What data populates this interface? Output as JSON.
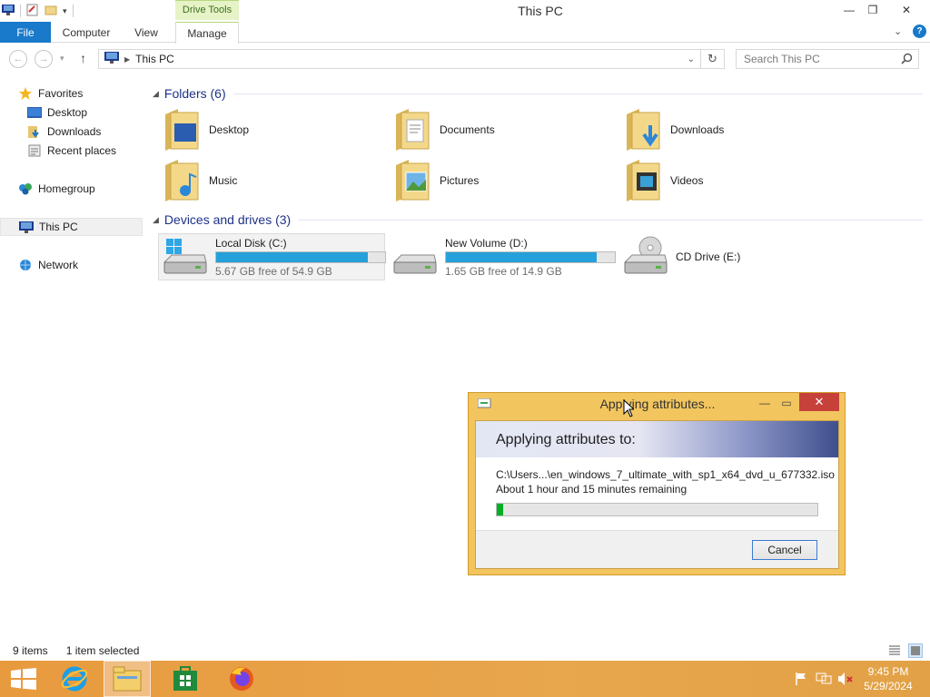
{
  "window": {
    "title": "This PC",
    "context_tab": "Drive Tools",
    "tabs": [
      "File",
      "Computer",
      "View",
      "Manage"
    ]
  },
  "address": {
    "path": "This PC",
    "search_placeholder": "Search This PC"
  },
  "nav": {
    "favorites": "Favorites",
    "desktop": "Desktop",
    "downloads": "Downloads",
    "recent": "Recent places",
    "homegroup": "Homegroup",
    "thispc": "This PC",
    "network": "Network"
  },
  "folders": {
    "header": "Folders (6)",
    "items": [
      "Desktop",
      "Documents",
      "Downloads",
      "Music",
      "Pictures",
      "Videos"
    ]
  },
  "drives": {
    "header": "Devices and drives (3)",
    "c": {
      "name": "Local Disk (C:)",
      "free": "5.67 GB free of 54.9 GB",
      "used_fraction": 0.9
    },
    "d": {
      "name": "New Volume (D:)",
      "free": "1.65 GB free of 14.9 GB",
      "used_fraction": 0.89
    },
    "e": {
      "name": "CD Drive (E:)"
    }
  },
  "status": {
    "items": "9 items",
    "selected": "1 item selected"
  },
  "dialog": {
    "title": "Applying attributes...",
    "heading": "Applying attributes to:",
    "file": "C:\\Users...\\en_windows_7_ultimate_with_sp1_x64_dvd_u_677332.iso",
    "remaining": "About 1 hour and 15 minutes remaining",
    "progress_fraction": 0.02,
    "cancel": "Cancel"
  },
  "taskbar": {
    "time": "9:45 PM",
    "date": "5/29/2024"
  },
  "colors": {
    "accent": "#1979ca",
    "progress": "#06b025",
    "drive_bar": "#26a0da",
    "taskbar": "#e89a3e",
    "dialog_frame": "#f2c55e"
  }
}
